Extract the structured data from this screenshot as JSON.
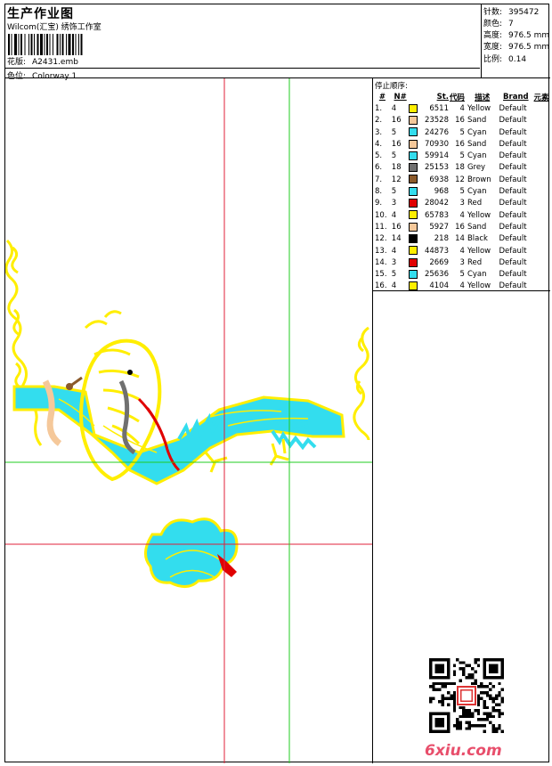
{
  "header": {
    "title": "生产作业图",
    "subtitle": "Wilcom(汇宝) 绣饰工作室",
    "design_label": "花版:",
    "design_value": "A2431.emb",
    "colorway_label": "色位:",
    "colorway_value": "Colorway 1"
  },
  "stats": [
    {
      "label": "针数:",
      "value": "395472"
    },
    {
      "label": "颜色:",
      "value": "7"
    },
    {
      "label": "高度:",
      "value": "976.5 mm"
    },
    {
      "label": "宽度:",
      "value": "976.5 mm"
    },
    {
      "label": "比例:",
      "value": "0.14"
    }
  ],
  "stop_sequence": {
    "title": "停止顺序:",
    "headers": {
      "no": "#",
      "n": "N#",
      "st": "St.",
      "code": "代码",
      "desc": "描述",
      "brand": "Brand",
      "element": "元素"
    },
    "rows": [
      {
        "no": "1.",
        "n": "4",
        "color": "#ffee00",
        "st": "6511",
        "code": "4",
        "desc": "Yellow",
        "brand": "Default"
      },
      {
        "no": "2.",
        "n": "16",
        "color": "#f5c89a",
        "st": "23528",
        "code": "16",
        "desc": "Sand",
        "brand": "Default"
      },
      {
        "no": "3.",
        "n": "5",
        "color": "#33ddee",
        "st": "24276",
        "code": "5",
        "desc": "Cyan",
        "brand": "Default"
      },
      {
        "no": "4.",
        "n": "16",
        "color": "#f5c89a",
        "st": "70930",
        "code": "16",
        "desc": "Sand",
        "brand": "Default"
      },
      {
        "no": "5.",
        "n": "5",
        "color": "#33ddee",
        "st": "59914",
        "code": "5",
        "desc": "Cyan",
        "brand": "Default"
      },
      {
        "no": "6.",
        "n": "18",
        "color": "#707070",
        "st": "25153",
        "code": "18",
        "desc": "Grey",
        "brand": "Default"
      },
      {
        "no": "7.",
        "n": "12",
        "color": "#8b5a2b",
        "st": "6938",
        "code": "12",
        "desc": "Brown",
        "brand": "Default"
      },
      {
        "no": "8.",
        "n": "5",
        "color": "#33ddee",
        "st": "968",
        "code": "5",
        "desc": "Cyan",
        "brand": "Default"
      },
      {
        "no": "9.",
        "n": "3",
        "color": "#e00000",
        "st": "28042",
        "code": "3",
        "desc": "Red",
        "brand": "Default"
      },
      {
        "no": "10.",
        "n": "4",
        "color": "#ffee00",
        "st": "65783",
        "code": "4",
        "desc": "Yellow",
        "brand": "Default"
      },
      {
        "no": "11.",
        "n": "16",
        "color": "#f5c89a",
        "st": "5927",
        "code": "16",
        "desc": "Sand",
        "brand": "Default"
      },
      {
        "no": "12.",
        "n": "14",
        "color": "#000000",
        "st": "218",
        "code": "14",
        "desc": "Black",
        "brand": "Default"
      },
      {
        "no": "13.",
        "n": "4",
        "color": "#ffee00",
        "st": "44873",
        "code": "4",
        "desc": "Yellow",
        "brand": "Default"
      },
      {
        "no": "14.",
        "n": "3",
        "color": "#e00000",
        "st": "2669",
        "code": "3",
        "desc": "Red",
        "brand": "Default"
      },
      {
        "no": "15.",
        "n": "5",
        "color": "#33ddee",
        "st": "25636",
        "code": "5",
        "desc": "Cyan",
        "brand": "Default"
      },
      {
        "no": "16.",
        "n": "4",
        "color": "#ffee00",
        "st": "4104",
        "code": "4",
        "desc": "Yellow",
        "brand": "Default"
      }
    ]
  },
  "watermark": "6xiu.com",
  "colors": {
    "yellow": "#ffee00",
    "cyan": "#33ddee",
    "red_guide": "#e0203a",
    "green_guide": "#22cc22"
  }
}
